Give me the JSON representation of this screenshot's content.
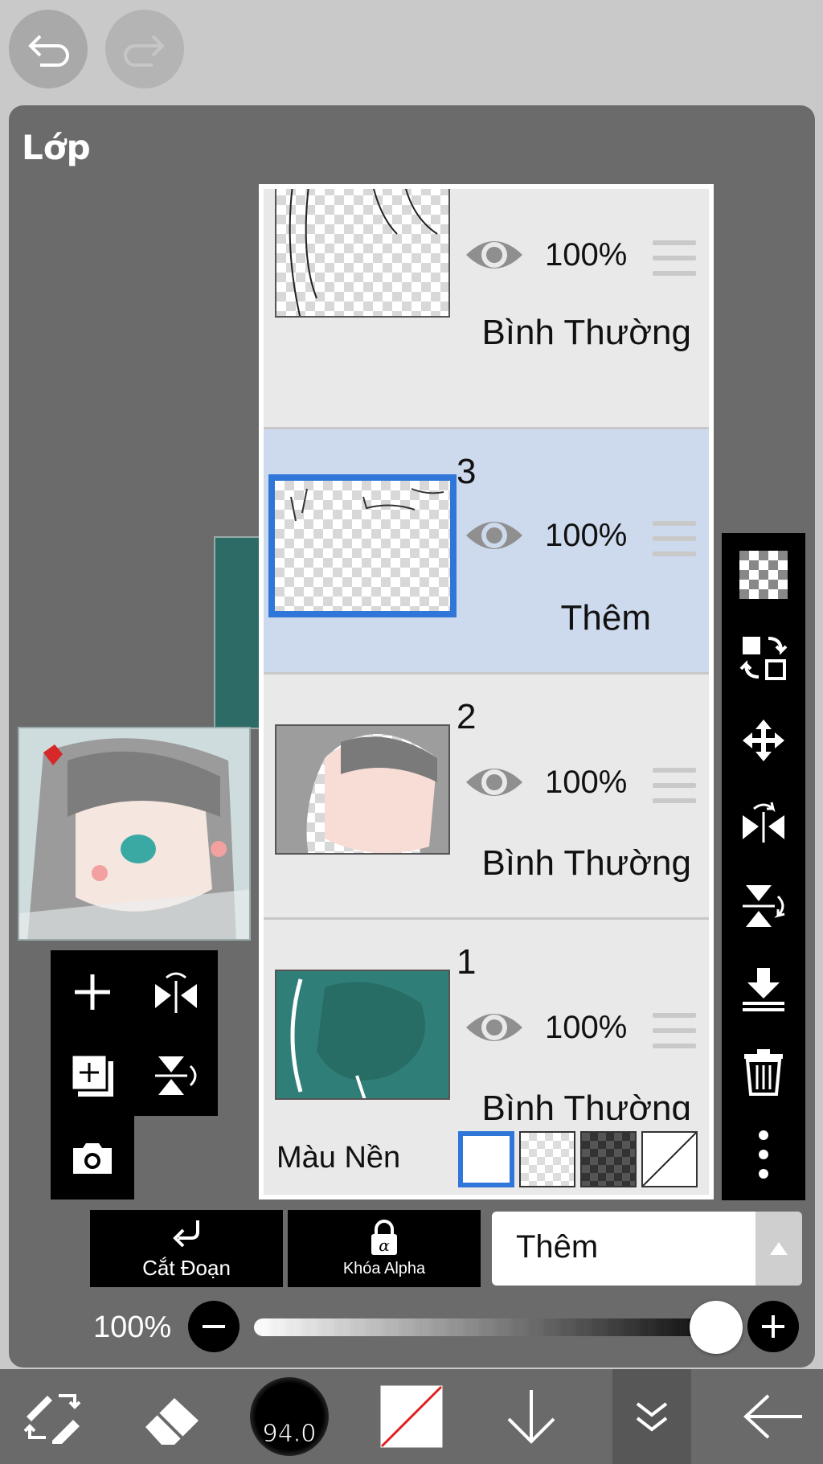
{
  "panel": {
    "title": "Lớp"
  },
  "layers": [
    {
      "number": "",
      "opacity": "100%",
      "blend": "Bình Thường",
      "selected": false
    },
    {
      "number": "3",
      "opacity": "100%",
      "blend": "Thêm",
      "selected": true
    },
    {
      "number": "2",
      "opacity": "100%",
      "blend": "Bình Thường",
      "selected": false
    },
    {
      "number": "1",
      "opacity": "100%",
      "blend": "Bình Thường",
      "selected": false
    }
  ],
  "background": {
    "label": "Màu Nền"
  },
  "actions": {
    "clipping_label": "Cắt Đoạn",
    "alpha_lock_label": "Khóa Alpha",
    "blend_mode_value": "Thêm"
  },
  "opacity_slider": {
    "label": "100%",
    "value_percent": 100
  },
  "brush": {
    "size_label": "94.0"
  },
  "colors": {
    "accent": "#2f76d8",
    "selected_row": "#cdd9ec",
    "panel": "#6b6b6b"
  }
}
